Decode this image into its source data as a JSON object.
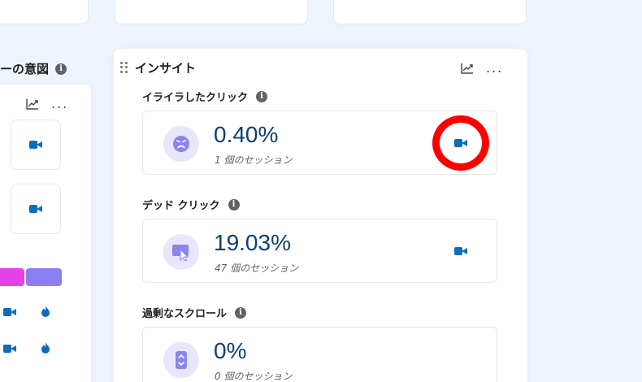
{
  "left_panel": {
    "title": "ーの意図",
    "info": "i",
    "more": "..."
  },
  "insights": {
    "title": "インサイト",
    "more": "...",
    "sections": [
      {
        "label": "イライラしたクリック",
        "value": "0.40%",
        "sessions": "1 個のセッション",
        "icon": "frown-face-icon"
      },
      {
        "label": "デッド クリック",
        "value": "19.03%",
        "sessions": "47 個のセッション",
        "icon": "dead-click-cursor-icon"
      },
      {
        "label": "過剰なスクロール",
        "value": "0%",
        "sessions": "0 個のセッション",
        "icon": "scroll-phone-icon"
      }
    ],
    "info": "i"
  },
  "colors": {
    "accent_blue": "#0f6cbd",
    "value_text": "#0f3f6e",
    "icon_bg": "#e8e6fb",
    "icon_fg": "#8c84ee",
    "bar_magenta": "#e840e8",
    "bar_violet": "#8a7ff2",
    "highlight": "#ff0000"
  }
}
